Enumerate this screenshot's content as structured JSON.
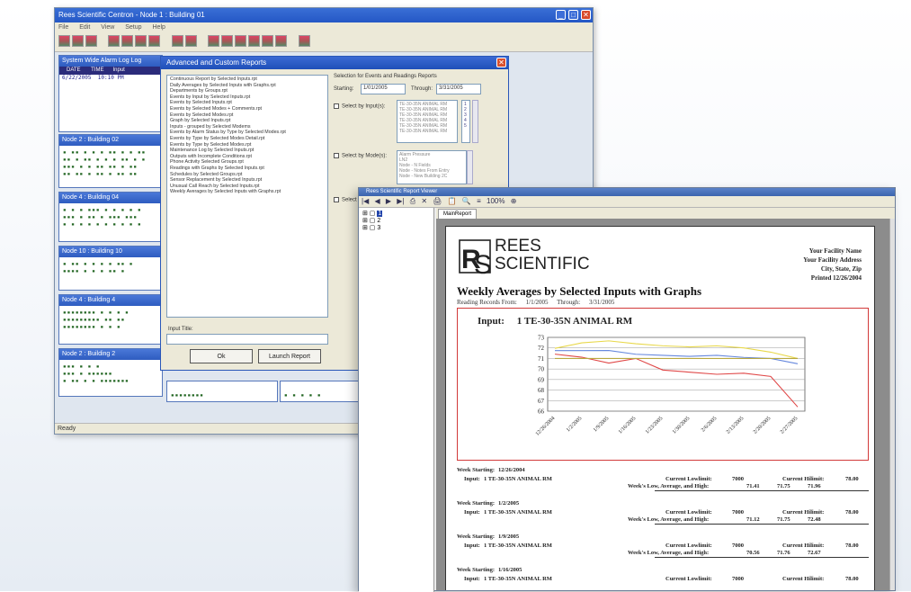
{
  "app": {
    "title": "Rees Scientific Centron - Node 1 : Building 01",
    "menu": [
      "File",
      "Edit",
      "View",
      "Setup",
      "Help"
    ],
    "status": "Ready"
  },
  "panels": [
    {
      "title": "System Wide Alarm Log Log",
      "header": [
        "DATE",
        "TIME",
        "Input"
      ],
      "row": [
        "6/22/2005",
        "10:10 PM",
        ""
      ]
    },
    {
      "title": "Node 2 : Building 02"
    },
    {
      "title": "Node 4 : Building 04"
    },
    {
      "title": "Node 10 : Building 10"
    },
    {
      "title": "Node 4 : Building 4"
    },
    {
      "title": "Node 2 : Building 2"
    }
  ],
  "dialog": {
    "title": "Advanced and Custom Reports",
    "reports": [
      "Continuous Report by Selected Inputs.rpt",
      "Daily Averages by Selected Inputs with Graphs.rpt",
      "Departments by Groups.rpt",
      "Events by Input by Selected Inputs.rpt",
      "Events by Selected Inputs.rpt",
      "Events by Selected Modes + Comments.rpt",
      "Events by Selected Modes.rpt",
      "Graph by Selected Inputs.rpt",
      "Inputs - grouped by Selected Modems",
      "Events by Alarm Status by Type by Selected Modes.rpt",
      "Events by Type by Selected Modes Detail.rpt",
      "Events by Type by Selected Modes.rpt",
      "Maintenance Log by Selected Inputs.rpt",
      "Outputs with Incomplete Conditions.rpt",
      "Phone Activity Selected Groups.rpt",
      "Readings with Graphs by Selected Inputs.rpt",
      "Schedules by Selected Groups.rpt",
      "Sensor Replacement by Selected Inputs.rpt",
      "Unusual Call Reach by Selected Inputs.rpt",
      "Weekly Averages by Selected Inputs with Graphs.rpt"
    ],
    "selection_title": "Selection for Events and Readings Reports",
    "starting_label": "Starting:",
    "starting_value": "1/01/2005",
    "through_label": "Through:",
    "through_value": "3/31/2005",
    "select_inputs_label": "Select by Input(s):",
    "inputs": [
      "TE-30-35N ANIMAL RM",
      "TE-30-35N ANIMAL RM",
      "TE-30-35N ANIMAL RM",
      "TE-30-35N ANIMAL RM",
      "TE-30-35N ANIMAL RM",
      "TE-30-35N ANIMAL RM"
    ],
    "select_modes_label": "Select by Mode(s):",
    "modes": [
      "Alarm Pressure",
      "LN2",
      "Node - N Fields",
      "Node - Notes From Entry",
      "Node - New Building 2C"
    ],
    "select_label": "Select",
    "input_title_label": "Input Title:",
    "ok_label": "Ok",
    "launch_label": "Launch Report"
  },
  "preview": {
    "title": "Rees Scientific Report Viewer",
    "nav": [
      "|◀",
      "◀",
      "▶",
      "▶|",
      "⎙",
      "✕",
      "🖨",
      "📋",
      "🔍",
      "≡",
      "100%",
      "⊕"
    ],
    "tree": [
      "1",
      "2",
      "3"
    ],
    "tab": "MainReport"
  },
  "report": {
    "logo_line1": "REES",
    "logo_line2": "SCIENTIFIC",
    "facility": [
      "Your Facility Name",
      "Your Facility Address",
      "City, State, Zip",
      "Printed 12/26/2004"
    ],
    "title": "Weekly Averages by Selected Inputs with Graphs",
    "range_label": "Reading Records From:",
    "range_from": "1/1/2005",
    "range_through_label": "Through:",
    "range_through": "3/31/2005",
    "input_label": "Input:",
    "input_value": "1 TE-30-35N ANIMAL RM",
    "weeks": [
      {
        "start_label": "Week Starting:",
        "start": "12/26/2004",
        "input_label": "Input:",
        "input": "1 TE-30-35N ANIMAL RM",
        "low_lbl": "Current Lowlimit:",
        "low": "7000",
        "high_lbl": "Current Hilimit:",
        "high": "78.00",
        "wk_lbl": "Week's Low, Average, and High:",
        "vals": [
          "71.41",
          "71.75",
          "71.96"
        ]
      },
      {
        "start_label": "Week Starting:",
        "start": "1/2/2005",
        "input_label": "Input:",
        "input": "1 TE-30-35N ANIMAL RM",
        "low_lbl": "Current Lowlimit:",
        "low": "7000",
        "high_lbl": "Current Hilimit:",
        "high": "78.00",
        "wk_lbl": "Week's Low, Average, and High:",
        "vals": [
          "71.12",
          "71.75",
          "72.48"
        ]
      },
      {
        "start_label": "Week Starting:",
        "start": "1/9/2005",
        "input_label": "Input:",
        "input": "1 TE-30-35N ANIMAL RM",
        "low_lbl": "Current Lowlimit:",
        "low": "7000",
        "high_lbl": "Current Hilimit:",
        "high": "78.00",
        "wk_lbl": "Week's Low, Average, and High:",
        "vals": [
          "70.56",
          "71.76",
          "72.67"
        ]
      },
      {
        "start_label": "Week Starting:",
        "start": "1/16/2005",
        "input_label": "Input:",
        "input": "1 TE-30-35N ANIMAL RM",
        "low_lbl": "Current Lowlimit:",
        "low": "7000",
        "high_lbl": "Current Hilimit:",
        "high": "78.00",
        "wk_lbl": "",
        "vals": []
      }
    ]
  },
  "chart_data": {
    "type": "line",
    "categories": [
      "12/26/2004",
      "1/2/2005",
      "1/9/2005",
      "1/16/2005",
      "1/23/2005",
      "1/30/2005",
      "2/6/2005",
      "2/13/2005",
      "2/20/2005",
      "2/27/2005"
    ],
    "series": [
      {
        "color": "#e8d84a",
        "values": [
          71.96,
          72.48,
          72.67,
          72.4,
          72.2,
          72.1,
          72.2,
          72.0,
          71.6,
          71.0
        ]
      },
      {
        "color": "#6688dd",
        "values": [
          71.75,
          71.75,
          71.76,
          71.4,
          71.3,
          71.2,
          71.3,
          71.1,
          71.0,
          70.5
        ]
      },
      {
        "color": "#e04848",
        "values": [
          71.41,
          71.12,
          70.56,
          71.0,
          69.9,
          69.7,
          69.5,
          69.6,
          69.3,
          66.4
        ]
      },
      {
        "color": "#b8a840",
        "values": [
          71,
          71,
          71,
          71,
          71,
          71,
          71,
          71,
          71,
          71
        ]
      }
    ],
    "yticks": [
      73,
      72,
      71,
      70,
      69,
      68,
      67,
      66
    ],
    "ylim": [
      66,
      73
    ]
  }
}
